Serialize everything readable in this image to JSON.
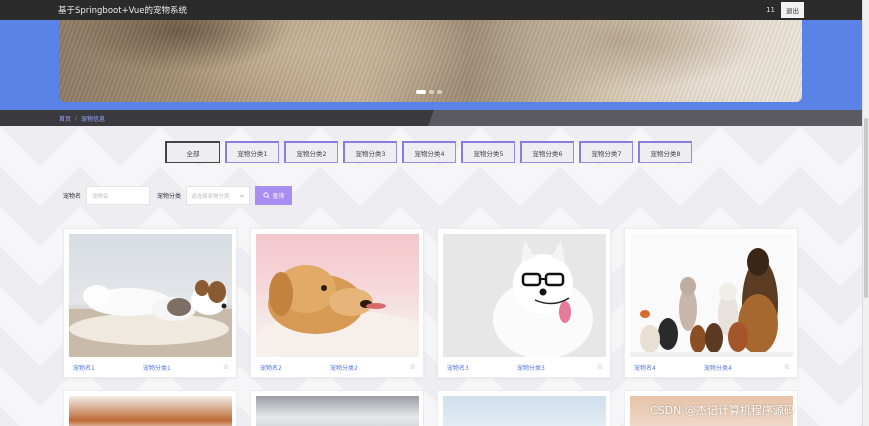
{
  "header": {
    "site_title": "基于Springboot+Vue的宠物系统",
    "user_name": "11",
    "logout_label": "退出"
  },
  "breadcrumb": {
    "home": "首页",
    "separator": "/",
    "current": "宠物信息"
  },
  "categories": [
    "全部",
    "宠物分类1",
    "宠物分类2",
    "宠物分类3",
    "宠物分类4",
    "宠物分类5",
    "宠物分类6",
    "宠物分类7",
    "宠物分类8"
  ],
  "search": {
    "name_label": "宠物名",
    "name_placeholder": "宠物名",
    "category_label": "宠物分类",
    "category_placeholder": "请选择宠物分类",
    "button_label": "查询"
  },
  "pets": [
    {
      "name": "宠物名1",
      "category": "宠物分类1"
    },
    {
      "name": "宠物名2",
      "category": "宠物分类2"
    },
    {
      "name": "宠物名3",
      "category": "宠物分类3"
    },
    {
      "name": "宠物名4",
      "category": "宠物分类4"
    }
  ],
  "carousel": {
    "slide_count": 3,
    "active_index": 0
  },
  "icons": {
    "favorite": "star-outline-icon",
    "search": "search-icon",
    "dropdown": "chevron-down-icon"
  },
  "colors": {
    "accent": "#a88ef0",
    "banner": "#5b82e6",
    "link": "#5a78d8"
  },
  "watermark": "CSDN @杰记计算机程序源码"
}
